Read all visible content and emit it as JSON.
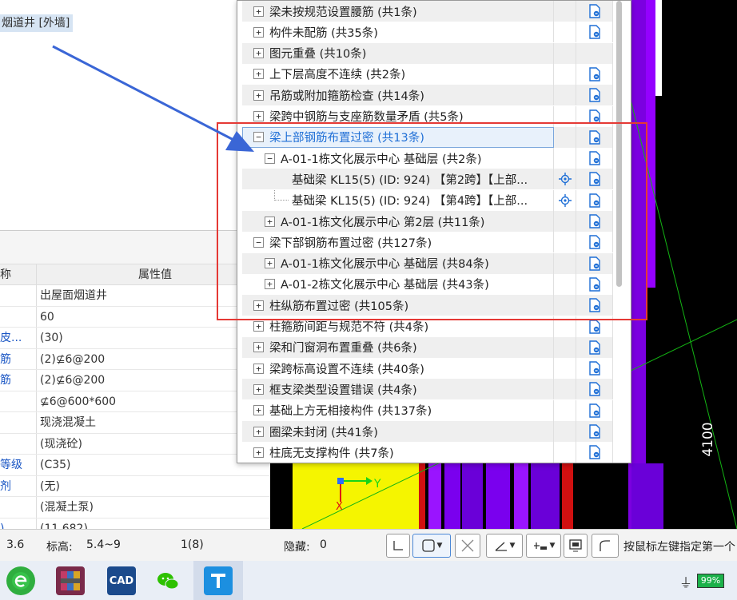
{
  "left_selection": "烟道井 [外墙]",
  "props": {
    "header_name": "称",
    "header_value": "属性值",
    "rows": [
      {
        "name": "",
        "value": "出屋面烟道井"
      },
      {
        "name": "",
        "value": "60"
      },
      {
        "name": "皮...",
        "value": "(30)"
      },
      {
        "name": "筋",
        "value": "(2)⊈6@200"
      },
      {
        "name": "筋",
        "value": "(2)⊈6@200"
      },
      {
        "name": "",
        "value": "⊈6@600*600"
      },
      {
        "name": "",
        "value": "现浇混凝土"
      },
      {
        "name": "",
        "value": "(现浇砼)"
      },
      {
        "name": "等级",
        "value": "(C35)"
      },
      {
        "name": "剂",
        "value": "(无)"
      },
      {
        "name": "",
        "value": "(混凝土泵)"
      },
      {
        "name": ")",
        "value": "(11.682)"
      }
    ]
  },
  "tree": [
    {
      "level": 0,
      "expander": "+",
      "label": "梁未按规范设置腰筋 (共1条)",
      "bg": "gray",
      "doc": true
    },
    {
      "level": 0,
      "expander": "+",
      "label": "构件未配筋 (共35条)",
      "bg": "white",
      "doc": true
    },
    {
      "level": 0,
      "expander": "+",
      "label": "图元重叠 (共10条)",
      "bg": "gray",
      "doc": false
    },
    {
      "level": 0,
      "expander": "+",
      "label": "上下层高度不连续 (共2条)",
      "bg": "white",
      "doc": true
    },
    {
      "level": 0,
      "expander": "+",
      "label": "吊筋或附加箍筋检查 (共14条)",
      "bg": "gray",
      "doc": true
    },
    {
      "level": 0,
      "expander": "+",
      "label": "梁跨中钢筋与支座筋数量矛盾 (共5条)",
      "bg": "white",
      "doc": true
    },
    {
      "level": 0,
      "expander": "−",
      "label": "梁上部钢筋布置过密 (共13条)",
      "bg": "gray",
      "doc": true,
      "selected": true
    },
    {
      "level": 1,
      "expander": "−",
      "label": "A-01-1栋文化展示中心 基础层 (共2条)",
      "bg": "white",
      "doc": true
    },
    {
      "level": 2,
      "expander": "",
      "label": "基础梁 KL15(5) (ID: 924) 【第2跨】【上部...",
      "bg": "gray",
      "doc": true,
      "loc": true
    },
    {
      "level": 2,
      "expander": "",
      "label": "基础梁 KL15(5) (ID: 924) 【第4跨】【上部...",
      "bg": "white",
      "doc": true,
      "loc": true,
      "line": true
    },
    {
      "level": 1,
      "expander": "+",
      "label": "A-01-1栋文化展示中心 第2层 (共11条)",
      "bg": "gray",
      "doc": true
    },
    {
      "level": 0,
      "expander": "−",
      "label": "梁下部钢筋布置过密 (共127条)",
      "bg": "white",
      "doc": true
    },
    {
      "level": 1,
      "expander": "+",
      "label": "A-01-1栋文化展示中心 基础层 (共84条)",
      "bg": "gray",
      "doc": true
    },
    {
      "level": 1,
      "expander": "+",
      "label": "A-01-2栋文化展示中心 基础层 (共43条)",
      "bg": "white",
      "doc": true
    },
    {
      "level": 0,
      "expander": "+",
      "label": "柱纵筋布置过密 (共105条)",
      "bg": "gray",
      "doc": true
    },
    {
      "level": 0,
      "expander": "+",
      "label": "柱箍筋间距与规范不符 (共4条)",
      "bg": "white",
      "doc": true
    },
    {
      "level": 0,
      "expander": "+",
      "label": "梁和门窗洞布置重叠 (共6条)",
      "bg": "gray",
      "doc": true
    },
    {
      "level": 0,
      "expander": "+",
      "label": "梁跨标高设置不连续 (共40条)",
      "bg": "white",
      "doc": true
    },
    {
      "level": 0,
      "expander": "+",
      "label": "框支梁类型设置错误 (共4条)",
      "bg": "gray",
      "doc": true
    },
    {
      "level": 0,
      "expander": "+",
      "label": "基础上方无相接构件 (共137条)",
      "bg": "white",
      "doc": true
    },
    {
      "level": 0,
      "expander": "+",
      "label": "圈梁未封闭 (共41条)",
      "bg": "gray",
      "doc": true
    },
    {
      "level": 0,
      "expander": "+",
      "label": "柱底无支撑构件 (共7条)",
      "bg": "white",
      "doc": true
    }
  ],
  "cad": {
    "dimension": "4100",
    "axis_y": "Y",
    "axis_x": "X"
  },
  "status": {
    "v1": "3.6",
    "elevation_label": "标高:",
    "elevation_value": "5.4~9",
    "count": "1(8)",
    "hidden_label": "隐藏:",
    "hidden_value": "0",
    "hint": "按鼠标左键指定第一个"
  },
  "taskbar": {
    "cad_label": "CAD",
    "battery": "99%"
  },
  "colors": {
    "highlight_box": "#e53935",
    "arrow": "#3a66d6",
    "selected_text": "#1f6fd6",
    "cad_background": "#000000"
  }
}
